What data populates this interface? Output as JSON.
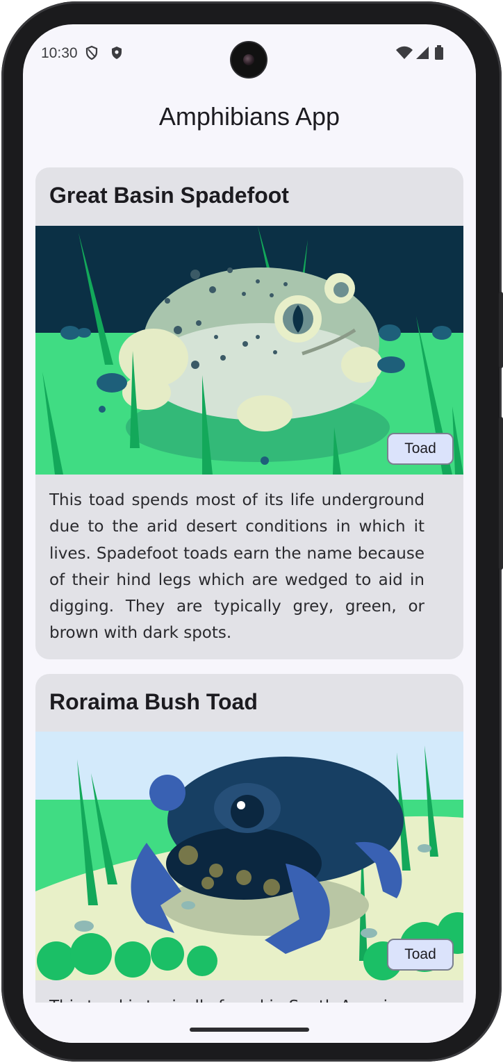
{
  "status_bar": {
    "time": "10:30",
    "icons": [
      "shield-outline-icon",
      "shield-filled-icon",
      "wifi-icon",
      "signal-icon",
      "battery-icon"
    ]
  },
  "app": {
    "title": "Amphibians App"
  },
  "cards": [
    {
      "name": "Great Basin Spadefoot",
      "type": "Toad",
      "description": "This toad spends most of its life underground due to the arid desert conditions in which it lives. Spadefoot toads earn the name because of their hind legs which are wedged to aid in digging. They are typically grey, green, or brown with dark spots."
    },
    {
      "name": "Roraima Bush Toad",
      "type": "Toad",
      "description": "This toad is typically found in South America."
    }
  ],
  "colors": {
    "background": "#f7f6fc",
    "card": "#e2e2e7",
    "chip": "#dbe3fb"
  }
}
